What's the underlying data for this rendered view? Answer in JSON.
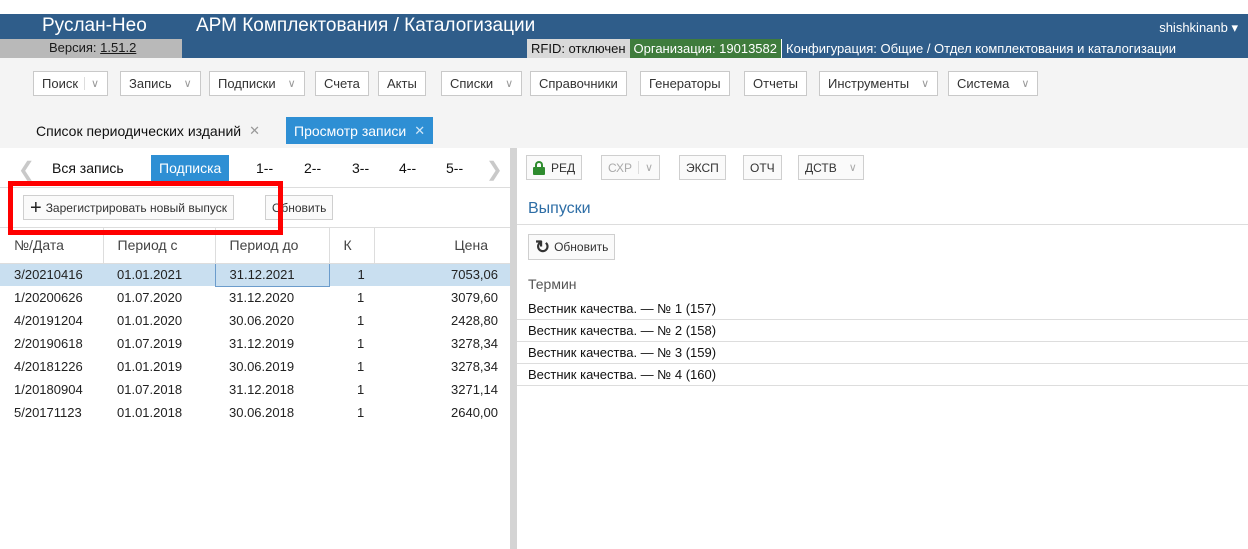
{
  "header": {
    "app_name": "Руслан-Нео",
    "app_title": "АРМ Комплектования / Каталогизации",
    "version_label": "Версия:",
    "version_number": "1.51.2",
    "user": "shishkinanb ▾",
    "rfid": "RFID: отключен",
    "organization": "Организация: 19013582",
    "configuration": "Конфигурация: Общие / Отдел комплектования и каталогизации"
  },
  "menu": {
    "search": "Поиск",
    "record": "Запись",
    "subscriptions": "Подписки",
    "accounts": "Счета",
    "acts": "Акты",
    "lists": "Списки",
    "references": "Справочники",
    "generators": "Генераторы",
    "reports": "Отчеты",
    "tools": "Инструменты",
    "system": "Система"
  },
  "tabs": {
    "periodicals": "Список периодических изданий",
    "view_record": "Просмотр записи"
  },
  "subtabs": [
    "Вся запись",
    "Подписка",
    "1--",
    "2--",
    "3--",
    "4--",
    "5--"
  ],
  "left_toolbar": {
    "register": "Зарегистрировать новый выпуск",
    "refresh": "Обновить"
  },
  "table": {
    "headers": [
      "№/Дата",
      "Период с",
      "Период до",
      "К",
      "Цена"
    ],
    "rows": [
      [
        "3/20210416",
        "01.01.2021",
        "31.12.2021",
        "1",
        "7053,06"
      ],
      [
        "1/20200626",
        "01.07.2020",
        "31.12.2020",
        "1",
        "3079,60"
      ],
      [
        "4/20191204",
        "01.01.2020",
        "30.06.2020",
        "1",
        "2428,80"
      ],
      [
        "2/20190618",
        "01.07.2019",
        "31.12.2019",
        "1",
        "3278,34"
      ],
      [
        "4/20181226",
        "01.01.2019",
        "30.06.2019",
        "1",
        "3278,34"
      ],
      [
        "1/20180904",
        "01.07.2018",
        "31.12.2018",
        "1",
        "3271,14"
      ],
      [
        "5/20171123",
        "01.01.2018",
        "30.06.2018",
        "1",
        "2640,00"
      ]
    ]
  },
  "right_toolbar": {
    "edit": "РЕД",
    "save": "СХР",
    "export": "ЭКСП",
    "report": "ОТЧ",
    "actions": "ДСТВ"
  },
  "issues": {
    "title": "Выпуски",
    "refresh": "Обновить",
    "column": "Термин",
    "items": [
      "Вестник качества. — № 1 (157)",
      "Вестник качества. — № 2 (158)",
      "Вестник качества. — № 3 (159)",
      "Вестник качества. — № 4 (160)"
    ]
  },
  "colors": {
    "header_bg": "#2f5d8a",
    "accent": "#2e8fd4",
    "org_bg": "#3f7c3c",
    "highlight": "#ff0000",
    "selected_row": "#c9dff0"
  }
}
